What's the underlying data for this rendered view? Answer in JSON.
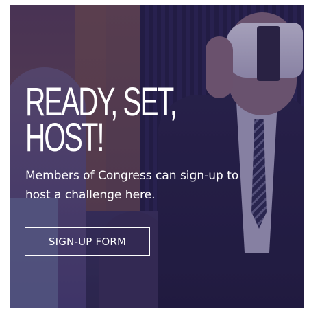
{
  "hero": {
    "headline_line1": "READY, SET,",
    "headline_line2": "HOST!",
    "description": "Members of Congress can sign-up to host a challenge here.",
    "cta_label": "SIGN-UP FORM"
  },
  "colors": {
    "overlay": "#2d2a48",
    "text": "#ffffff"
  }
}
